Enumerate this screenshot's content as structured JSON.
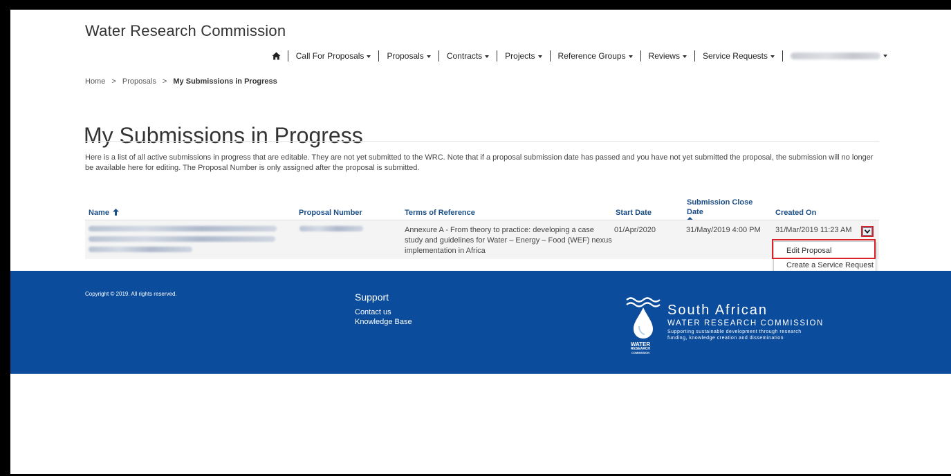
{
  "header": {
    "site_title": "Water Research Commission",
    "nav": {
      "home_icon": "home-icon",
      "items": [
        {
          "label": "Call For Proposals"
        },
        {
          "label": "Proposals"
        },
        {
          "label": "Contracts"
        },
        {
          "label": "Projects"
        },
        {
          "label": "Reference Groups"
        },
        {
          "label": "Reviews"
        },
        {
          "label": "Service Requests"
        }
      ],
      "user_menu": "redacted-user-name"
    }
  },
  "breadcrumb": {
    "items": [
      "Home",
      ">",
      "Proposals",
      ">"
    ],
    "current": "My Submissions in Progress"
  },
  "page": {
    "title": "My Submissions in Progress",
    "intro": "Here is a list of all active submissions in progress that are editable. They are not yet submitted to the WRC. Note that if a proposal submission date has passed and you have not yet submitted the proposal, the submission will no longer be available here for editing. The Proposal Number is only assigned after the proposal is submitted."
  },
  "table": {
    "columns": {
      "name": "Name",
      "proposal_number": "Proposal Number",
      "terms": "Terms of Reference",
      "start_date": "Start Date",
      "close_date": "Submission Close Date",
      "created_on": "Created On"
    },
    "sort_icon": "arrow-up-icon",
    "rows": [
      {
        "name": "(redacted)",
        "proposal_number": "(redacted)",
        "terms": "Annexure A - From theory to practice: developing a case study and guidelines for Water – Energy – Food (WEF) nexus implementation in Africa",
        "start_date": "01/Apr/2020",
        "close_date": "31/May/2019 4:00 PM",
        "created_on": "31/Mar/2019 11:23 AM"
      }
    ],
    "row_menu": {
      "edit": "Edit Proposal",
      "service": "Create a Service Request"
    }
  },
  "footer": {
    "copyright": "Copyright © 2019. All rights reserved.",
    "support_title": "Support",
    "links": [
      "Contact us",
      "Knowledge Base"
    ],
    "brand": {
      "line1": "South African",
      "line2": "WATER RESEARCH COMMISSION",
      "line3a": "Supporting sustainable development through research",
      "line3b": "funding, knowledge creation and dissemination",
      "logo_text": [
        "WATER",
        "RESEARCH",
        "COMMISSION"
      ]
    }
  },
  "colors": {
    "footer_bg": "#0b4c9c",
    "header_link": "#1a4e86",
    "highlight": "#d9232a"
  }
}
